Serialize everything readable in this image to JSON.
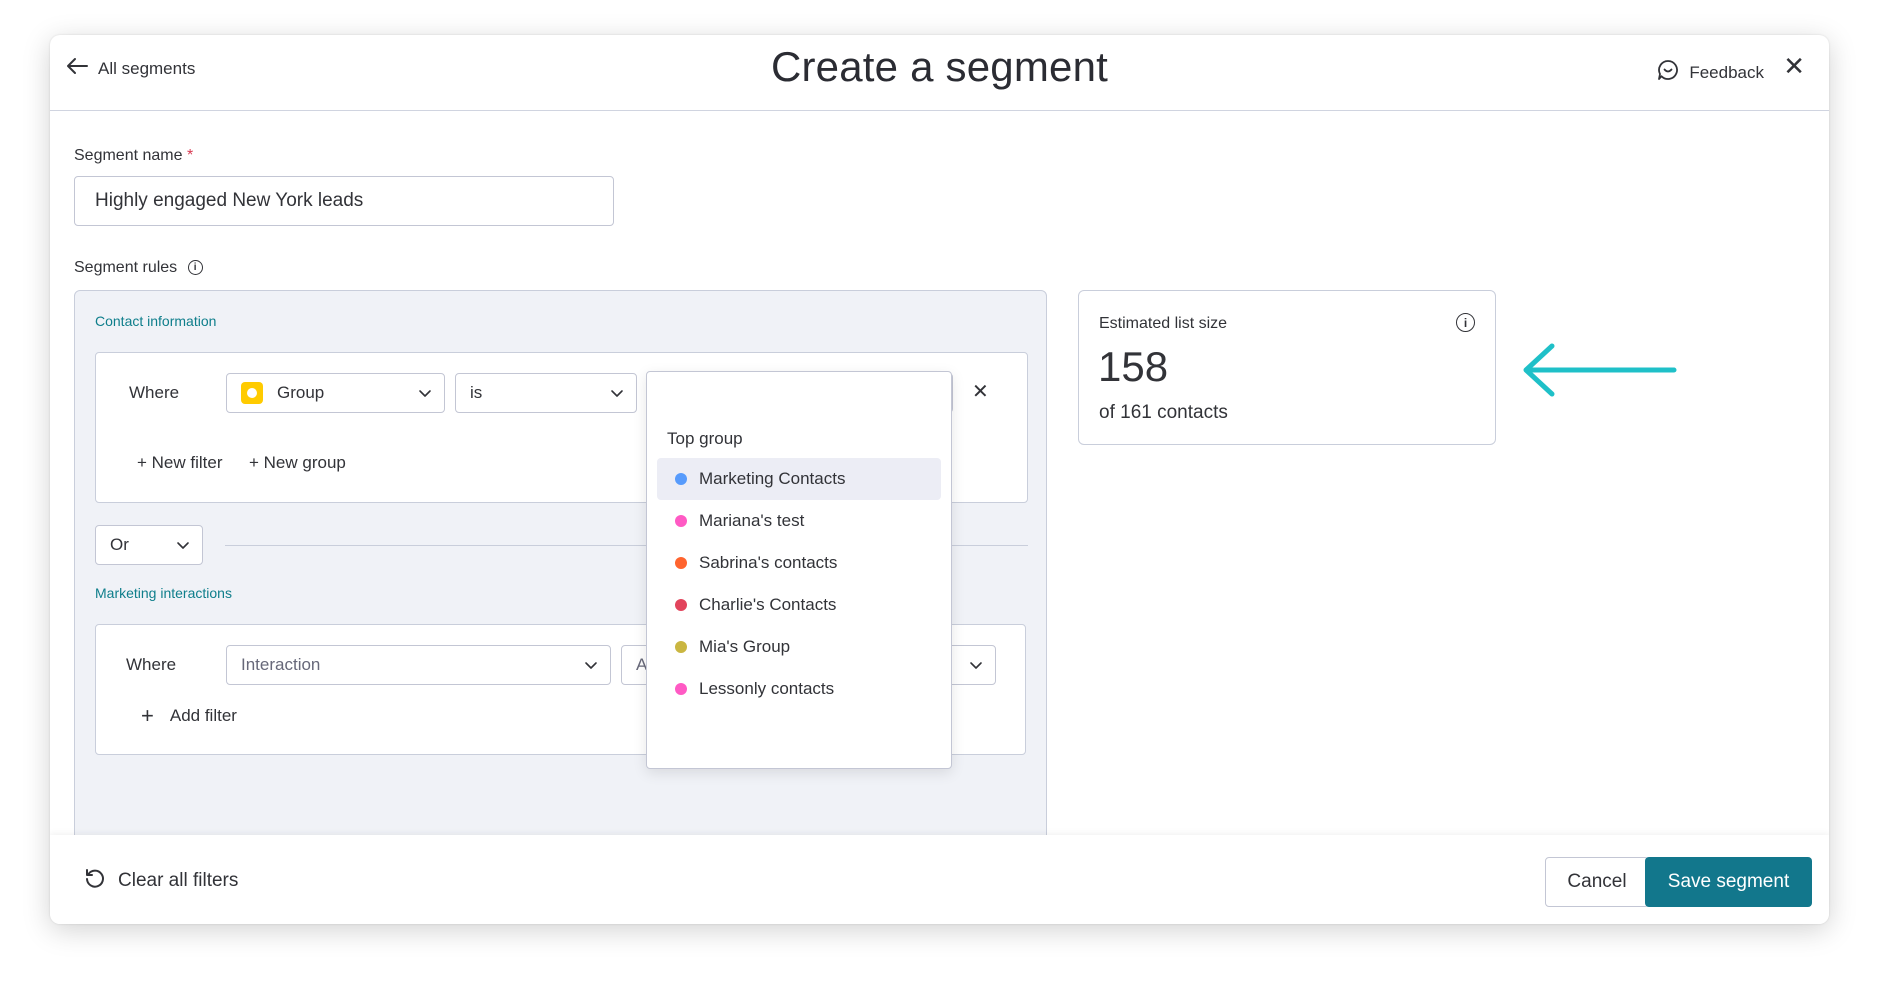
{
  "header": {
    "back_label": "All segments",
    "title": "Create a segment",
    "feedback_label": "Feedback",
    "close_symbol": "✕"
  },
  "form": {
    "segment_name_label": "Segment name",
    "required_mark": "*",
    "segment_name_value": "Highly engaged New York leads",
    "segment_rules_label": "Segment rules"
  },
  "contact_info": {
    "section_title": "Contact information",
    "where_label": "Where",
    "field_select": "Group",
    "operator_select": "is",
    "value_select": "",
    "remove_symbol": "✕",
    "new_filter": "+ New filter",
    "new_group": "+ New group"
  },
  "conjunction": {
    "value": "Or"
  },
  "marketing": {
    "section_title": "Marketing interactions",
    "where_label": "Where",
    "field_select": "Interaction",
    "operator_partial": "A",
    "add_filter": "Add filter"
  },
  "dropdown": {
    "heading": "Top group",
    "items": [
      {
        "label": "Marketing Contacts",
        "color": "#579bfc"
      },
      {
        "label": "Mariana's test",
        "color": "#ff5ac4"
      },
      {
        "label": "Sabrina's contacts",
        "color": "#ff642e"
      },
      {
        "label": "Charlie's Contacts",
        "color": "#e2445c"
      },
      {
        "label": "Mia's Group",
        "color": "#cab641"
      },
      {
        "label": "Lessonly contacts",
        "color": "#ff5ac4"
      }
    ]
  },
  "estimate": {
    "label": "Estimated list size",
    "value": "158",
    "sub": "of 161 contacts"
  },
  "footer": {
    "clear_label": "Clear all filters",
    "cancel_label": "Cancel",
    "save_label": "Save segment"
  },
  "colors": {
    "accent": "#12778c",
    "section_title": "#0e7e8b",
    "arrow": "#1fc0c8",
    "group_swatch": "#ffcb00"
  }
}
